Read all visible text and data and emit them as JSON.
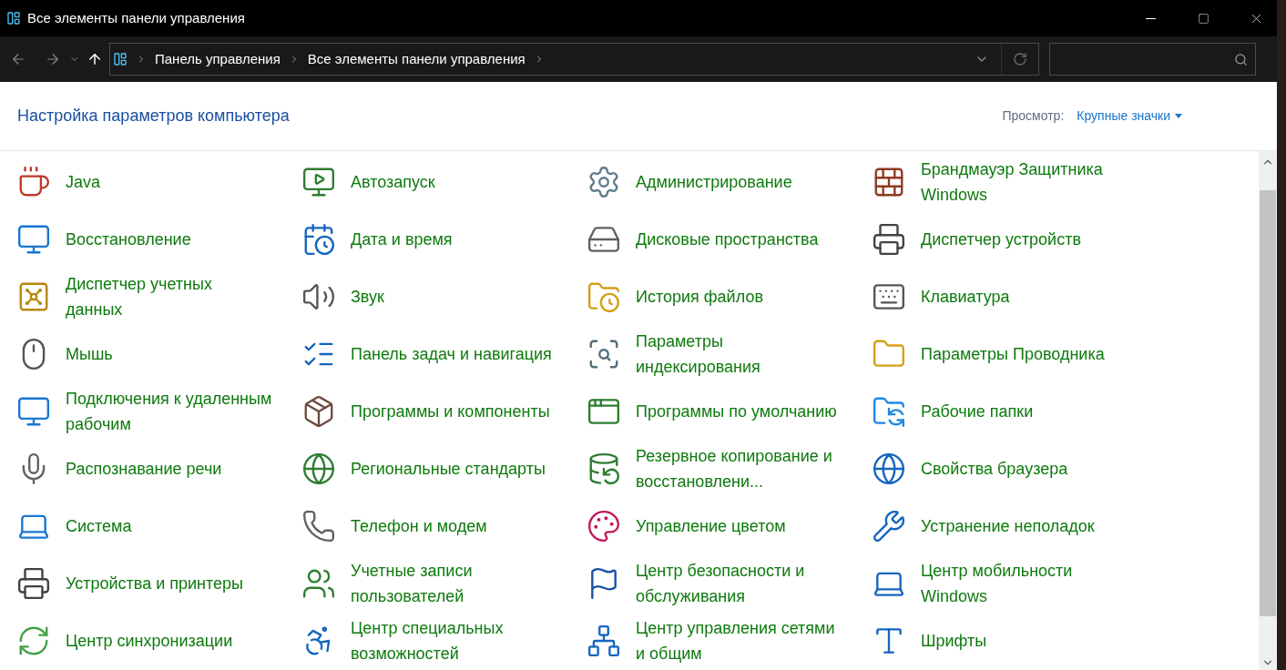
{
  "window": {
    "title": "Все элементы панели управления"
  },
  "address_bar": {
    "breadcrumbs": [
      "Панель управления",
      "Все элементы панели управления"
    ]
  },
  "header": {
    "title": "Настройка параметров компьютера",
    "view_label": "Просмотр:",
    "view_value": "Крупные значки"
  },
  "items": [
    {
      "label": "Java"
    },
    {
      "label": "Автозапуск"
    },
    {
      "label": "Администрирование"
    },
    {
      "label": "Брандмауэр Защитника Windows"
    },
    {
      "label": "Восстановление"
    },
    {
      "label": "Дата и время"
    },
    {
      "label": "Дисковые пространства"
    },
    {
      "label": "Диспетчер устройств"
    },
    {
      "label": "Диспетчер учетных данных"
    },
    {
      "label": "Звук"
    },
    {
      "label": "История файлов"
    },
    {
      "label": "Клавиатура"
    },
    {
      "label": "Мышь"
    },
    {
      "label": "Панель задач и навигация"
    },
    {
      "label": "Параметры индексирования"
    },
    {
      "label": "Параметры Проводника"
    },
    {
      "label": "Подключения к удаленным рабочим"
    },
    {
      "label": "Программы и компоненты"
    },
    {
      "label": "Программы по умолчанию"
    },
    {
      "label": "Рабочие папки"
    },
    {
      "label": "Распознавание речи"
    },
    {
      "label": "Региональные стандарты"
    },
    {
      "label": "Резервное копирование и восстановлени..."
    },
    {
      "label": "Свойства браузера"
    },
    {
      "label": "Система"
    },
    {
      "label": "Телефон и модем"
    },
    {
      "label": "Управление цветом"
    },
    {
      "label": "Устранение неполадок"
    },
    {
      "label": "Устройства и принтеры"
    },
    {
      "label": "Учетные записи пользователей"
    },
    {
      "label": "Центр безопасности и обслуживания"
    },
    {
      "label": "Центр мобильности Windows"
    },
    {
      "label": "Центр синхронизации"
    },
    {
      "label": "Центр специальных возможностей"
    },
    {
      "label": "Центр управления сетями и общим"
    },
    {
      "label": "Шрифты"
    }
  ]
}
